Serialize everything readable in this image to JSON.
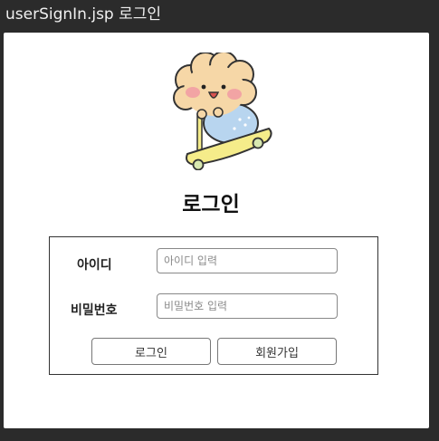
{
  "window": {
    "title": "userSignIn.jsp 로그인"
  },
  "mascot": {
    "icon": "bear-on-scooter-icon"
  },
  "page": {
    "heading": "로그인"
  },
  "form": {
    "id_label": "아이디",
    "id_placeholder": "아이디 입력",
    "id_value": "",
    "pw_label": "비밀번호",
    "pw_placeholder": "비밀번호 입력",
    "pw_value": "",
    "login_button": "로그인",
    "signup_button": "회원가입"
  },
  "colors": {
    "titlebar_bg": "#2b2b2b",
    "page_bg": "#ffffff",
    "scooter_yellow": "#f5ec8a",
    "bear_fur": "#f6d7a7"
  }
}
